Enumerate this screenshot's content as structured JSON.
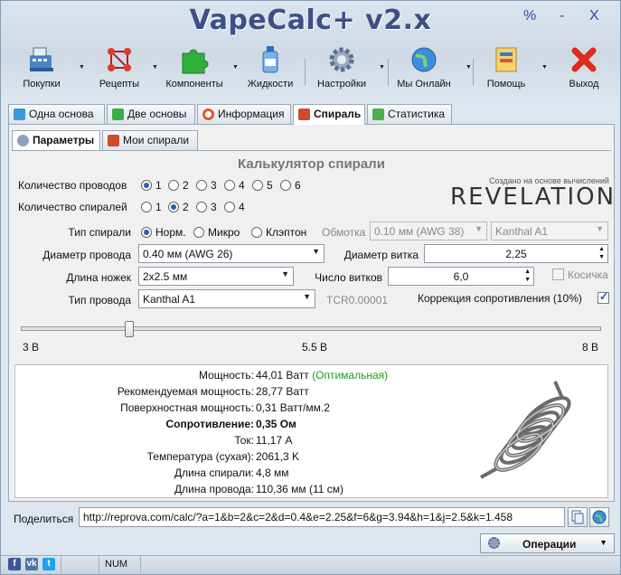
{
  "app": {
    "title": "VapeCalc+ v2.x",
    "window_buttons": [
      "%",
      "-",
      "X"
    ]
  },
  "toolbar": [
    {
      "label": "Покупки",
      "icon": "cash-register-icon",
      "dropdown": true
    },
    {
      "label": "Рецепты",
      "icon": "molecule-icon",
      "dropdown": true
    },
    {
      "label": "Компоненты",
      "icon": "puzzle-icon",
      "dropdown": true
    },
    {
      "label": "Жидкости",
      "icon": "bottle-icon",
      "dropdown": false
    },
    {
      "label": "Настройки",
      "icon": "gear-icon",
      "dropdown": true
    },
    {
      "label": "Мы Онлайн",
      "icon": "globe-icon",
      "dropdown": true
    },
    {
      "label": "Помощь",
      "icon": "help-book-icon",
      "dropdown": true
    },
    {
      "label": "Выход",
      "icon": "exit-x-icon",
      "dropdown": false
    }
  ],
  "main_tabs": [
    "Одна основа",
    "Две основы",
    "Информация",
    "Спираль",
    "Статистика"
  ],
  "main_tab_active": "Спираль",
  "sub_tabs": [
    "Параметры",
    "Мои спирали"
  ],
  "calc_title": "Калькулятор спирали",
  "credit": "Создано на основе вычислений",
  "logo_text": "REVELATION",
  "form": {
    "wires_label": "Количество проводов",
    "wires_options": [
      "1",
      "2",
      "3",
      "4",
      "5",
      "6"
    ],
    "wires_selected": "1",
    "coils_label": "Количество спиралей",
    "coils_options": [
      "1",
      "2",
      "3",
      "4"
    ],
    "coils_selected": "2",
    "coil_type_label": "Тип спирали",
    "coil_types": [
      "Норм.",
      "Микро",
      "Клэптон"
    ],
    "coil_type_selected": "Норм.",
    "wrap_label": "Обмотка",
    "wrap_value": "0.10 мм (AWG 38)",
    "wrap_material": "Kanthal A1",
    "wire_diameter_label": "Диаметр провода",
    "wire_diameter_value": "0.40 мм (AWG 26)",
    "coil_diameter_label": "Диаметр витка",
    "coil_diameter_value": "2,25",
    "leg_length_label": "Длина ножек",
    "leg_length_value": "2x2.5 мм",
    "wraps_label": "Число витков",
    "wraps_value": "6,0",
    "braid_label": "Косичка",
    "braid_checked": false,
    "wire_type_label": "Тип провода",
    "wire_type_value": "Kanthal A1",
    "tcr_text": "TCR0.00001",
    "resistance_correction_label": "Коррекция сопротивления (10%)",
    "resistance_correction_checked": true
  },
  "voltage_slider": {
    "min_label": "3 В",
    "mid_label": "5.5 В",
    "max_label": "8 В",
    "value_fraction": 0.19
  },
  "results": [
    {
      "label": "Мощность:",
      "value": "44,01 Ватт",
      "extra": "(Оптимальная)",
      "bold": false
    },
    {
      "label": "Рекомендуемая мощность:",
      "value": "28,77 Ватт",
      "bold": false
    },
    {
      "label": "Поверхностная мощность:",
      "value": "0,31 Ватт/мм.2",
      "bold": false
    },
    {
      "label": "Сопротивление:",
      "value": "0,35 Ом",
      "bold": true
    },
    {
      "label": "Ток:",
      "value": "11,17 А",
      "bold": false
    },
    {
      "label": "Температура (сухая):",
      "value": "2061,3 K",
      "bold": false
    },
    {
      "label": "Длина спирали:",
      "value": "4,8 мм",
      "bold": false
    },
    {
      "label": "Длина провода:",
      "value": "110,36 мм (11 см)",
      "bold": false
    }
  ],
  "colors": {
    "optimal_green": "#1aa01a",
    "title_blue": "#3f4f86"
  },
  "share": {
    "label": "Поделиться",
    "url": "http://reprova.com/calc/?a=1&b=2&c=2&d=0.4&e=2.25&f=6&g=3.94&h=1&j=2.5&k=1.458"
  },
  "operations_label": "Операции",
  "status_bar": {
    "num": "NUM"
  }
}
